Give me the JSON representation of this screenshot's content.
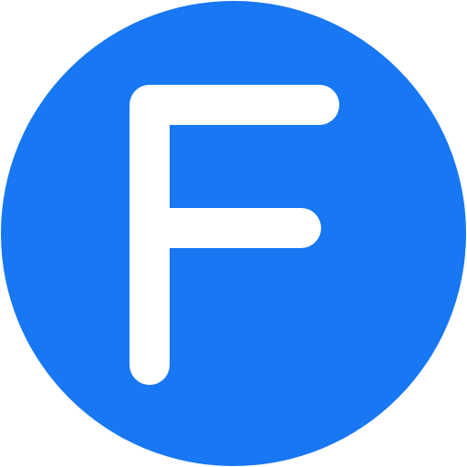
{
  "logo": {
    "letter": "F",
    "background_color": "#1877F2",
    "letter_color": "#FFFFFF"
  }
}
